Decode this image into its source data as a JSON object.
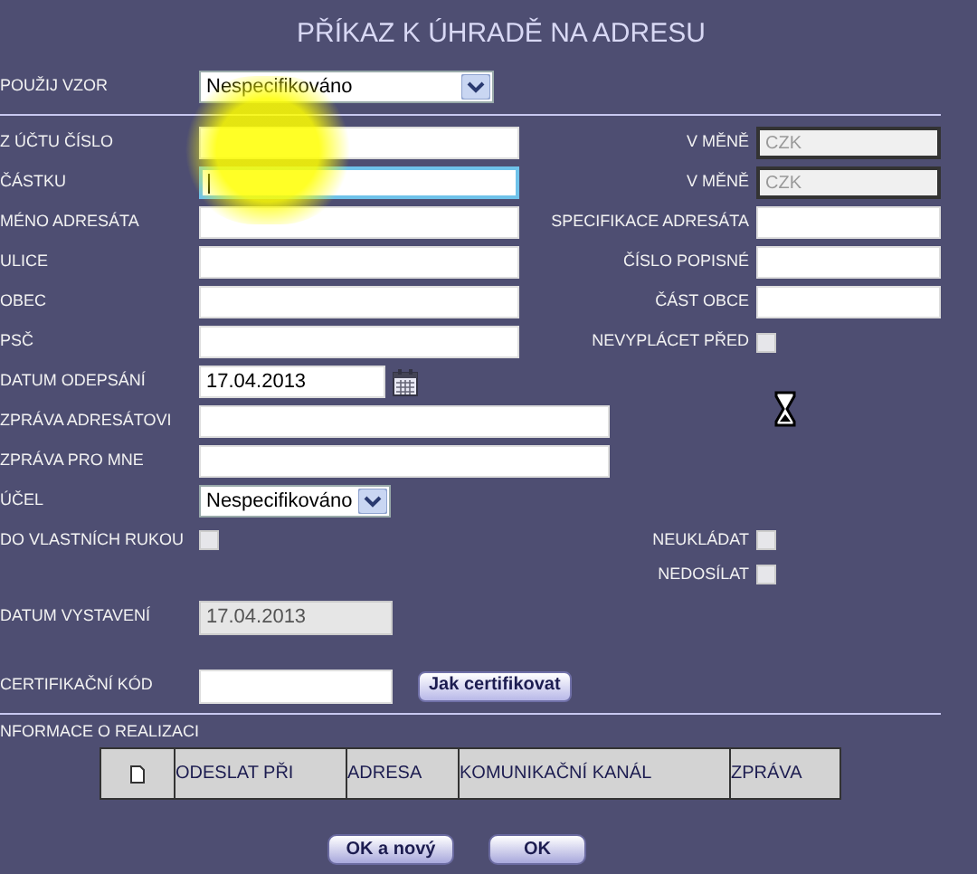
{
  "title": "PŘÍKAZ K ÚHRADĚ NA ADRESU",
  "template": {
    "label": "POUŽIJ VZOR",
    "value": "Nespecifikováno"
  },
  "rows": [
    {
      "left": {
        "kind": "text",
        "label": "Z ÚČTU ČÍSLO",
        "focused": false
      },
      "right": {
        "kind": "currency",
        "label": "V MĚNĚ",
        "value": "CZK"
      }
    },
    {
      "left": {
        "kind": "text",
        "label": "ČÁSTKU",
        "focused": true
      },
      "right": {
        "kind": "currency",
        "label": "V MĚNĚ",
        "value": "CZK"
      }
    },
    {
      "left": {
        "kind": "text",
        "label": "MÉNO ADRESÁTA",
        "focused": false
      },
      "right": {
        "kind": "text",
        "label": "SPECIFIKACE ADRESÁTA",
        "focused": false
      }
    },
    {
      "left": {
        "kind": "text",
        "label": "ULICE",
        "focused": false
      },
      "right": {
        "kind": "text",
        "label": "ČÍSLO POPISNÉ",
        "focused": false
      }
    },
    {
      "left": {
        "kind": "text",
        "label": "OBEC",
        "focused": false
      },
      "right": {
        "kind": "text",
        "label": "ČÁST OBCE",
        "focused": false
      }
    },
    {
      "left": {
        "kind": "text",
        "label": "PSČ",
        "focused": false
      },
      "right": {
        "kind": "checkbox",
        "label": "NEVYPLÁCET PŘED",
        "checked": false
      }
    },
    {
      "left": {
        "kind": "date",
        "label": "DATUM ODEPSÁNÍ",
        "value": "17.04.2013"
      }
    },
    {
      "left": {
        "kind": "wide",
        "label": "ZPRÁVA ADRESÁTOVI",
        "focused": false
      }
    },
    {
      "left": {
        "kind": "wide",
        "label": "ZPRÁVA PRO MNE",
        "focused": false
      }
    },
    {
      "left": {
        "kind": "select",
        "label": "ÚČEL",
        "value": "Nespecifikováno"
      }
    },
    {
      "left": {
        "kind": "checkbox",
        "label": "DO VLASTNÍCH RUKOU",
        "checked": false
      },
      "right": {
        "kind": "checkbox",
        "label": "NEUKLÁDAT",
        "checked": false
      }
    },
    {
      "right": {
        "kind": "checkbox",
        "label": "NEDOSÍLAT",
        "checked": false
      }
    },
    {
      "left": {
        "kind": "readonly",
        "label": "DATUM VYSTAVENÍ",
        "value": "17.04.2013"
      }
    },
    {
      "left": {
        "kind": "code",
        "label": "CERTIFIKAČNÍ KÓD",
        "button": "Jak certifikovat"
      }
    }
  ],
  "realization": {
    "title": "NFORMACE O REALIZACI",
    "columns": [
      "ODESLAT PŘI",
      "ADRESA",
      "KOMUNIKAČNÍ KANÁL",
      "ZPRÁVA"
    ]
  },
  "buttons": [
    "OK a nový",
    "OK"
  ]
}
